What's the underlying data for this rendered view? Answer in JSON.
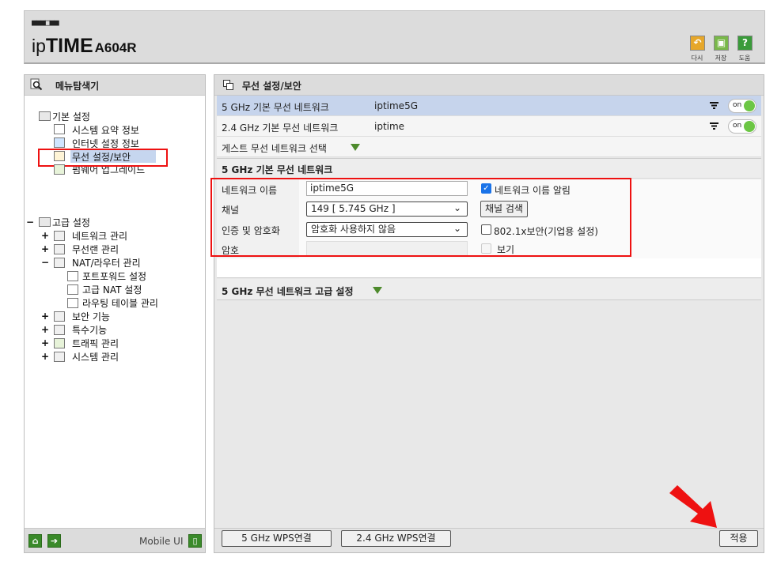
{
  "header": {
    "logo_dots": "■■■□■■",
    "brand_prefix": "ip",
    "brand_bold": "TIME",
    "model": "A604R",
    "buttons": [
      {
        "label": "다시",
        "icon": "undo-icon",
        "color": "#e6a72a"
      },
      {
        "label": "저장",
        "icon": "save-icon",
        "color": "#79b84a"
      },
      {
        "label": "도움",
        "icon": "help-icon",
        "color": "#3a9b3a"
      }
    ]
  },
  "sidebar": {
    "title": "메뉴탐색기",
    "basic_group": "기본 설정",
    "basic_items": [
      "시스템 요약 정보",
      "인터넷 설정 정보",
      "무선 설정/보안",
      "펌웨어 업그레이드"
    ],
    "advanced_toggle": "−",
    "advanced_group": "고급 설정",
    "advanced_items": [
      {
        "toggle": "+",
        "label": "네트워크 관리"
      },
      {
        "toggle": "+",
        "label": "무선랜 관리"
      },
      {
        "toggle": "−",
        "label": "NAT/라우터 관리"
      }
    ],
    "nat_items": [
      "포트포워드 설정",
      "고급 NAT 설정",
      "라우팅 테이블 관리"
    ],
    "more_items": [
      {
        "toggle": "+",
        "label": "보안 기능"
      },
      {
        "toggle": "+",
        "label": "특수기능"
      },
      {
        "toggle": "+",
        "label": "트래픽 관리"
      },
      {
        "toggle": "+",
        "label": "시스템 관리"
      }
    ],
    "mobile_label": "Mobile UI"
  },
  "main": {
    "title": "무선 설정/보안",
    "networks": [
      {
        "name": "5 GHz 기본 무선 네트워크",
        "ssid": "iptime5G",
        "toggle": "on"
      },
      {
        "name": "2.4 GHz 기본 무선 네트워크",
        "ssid": "iptime",
        "toggle": "on"
      }
    ],
    "guest_label": "게스트 무선 네트워크 선택",
    "section_title": "5 GHz 기본 무선 네트워크",
    "form": {
      "name_label": "네트워크 이름",
      "name_value": "iptime5G",
      "broadcast_label": "네트워크 이름 알림",
      "channel_label": "채널",
      "channel_value": "149 [ 5.745 GHz ]",
      "channel_search": "채널 검색",
      "auth_label": "인증 및 암호화",
      "auth_value": "암호화 사용하지 않음",
      "dot1x_label": "802.1x보안(기업용 설정)",
      "password_label": "암호",
      "show_label": "보기"
    },
    "advanced_label": "5 GHz 무선 네트워크 고급 설정",
    "footer": {
      "wps5": "5 GHz WPS연결",
      "wps24": "2.4 GHz WPS연결",
      "apply": "적용"
    }
  }
}
